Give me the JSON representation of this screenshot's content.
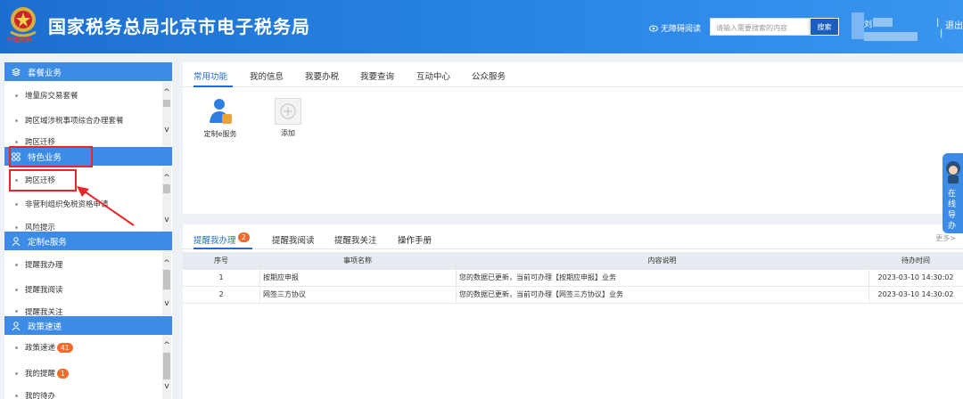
{
  "header": {
    "title": "国家税务总局北京市电子税务局",
    "emblem_text": "中国税务",
    "accessibility": "无障碍阅读",
    "search_placeholder": "请输入需要搜索的内容",
    "search_button": "搜索",
    "user_name": "刘",
    "logout": "退出"
  },
  "sidebar": {
    "sections": [
      {
        "title": "套餐业务",
        "items": [
          "增量房交易套餐",
          "跨区域涉税事项综合办理套餐",
          "跨区迁移"
        ]
      },
      {
        "title": "特色业务",
        "items": [
          "跨区迁移",
          "非营利组织免税资格申请",
          "风险提示"
        ]
      },
      {
        "title": "定制e服务",
        "items": [
          "提醒我办理",
          "提醒我阅读",
          "提醒我关注"
        ]
      },
      {
        "title": "政策速递",
        "items": [
          "政策速递",
          "我的提醒",
          "我的待办"
        ],
        "badges": [
          "41",
          "1"
        ]
      }
    ]
  },
  "top_panel": {
    "tabs": [
      "常用功能",
      "我的信息",
      "我要办税",
      "我要查询",
      "互动中心",
      "公众服务"
    ],
    "tiles": [
      "定制e服务",
      "添加"
    ]
  },
  "bottom_panel": {
    "tabs": [
      "提醒我办理",
      "提醒我阅读",
      "提醒我关注",
      "操作手册"
    ],
    "badge": "2",
    "more": "更多>",
    "columns": [
      "序号",
      "事项名称",
      "内容说明",
      "待办时间"
    ],
    "rows": [
      [
        "1",
        "按期应申报",
        "您的数据已更新，当前可办理【按期应申报】业务",
        "2023-03-10 14:30:02"
      ],
      [
        "2",
        "网签三方协议",
        "您的数据已更新，当前可办理【网签三方协议】业务",
        "2023-03-10 14:30:02"
      ]
    ]
  },
  "float_helper": "在线导办",
  "colors": {
    "header": "#2a87e6",
    "accent": "#1f6cd6",
    "section": "#3c8ce6",
    "badge": "#f26b2c",
    "annotation": "#e8262a"
  }
}
